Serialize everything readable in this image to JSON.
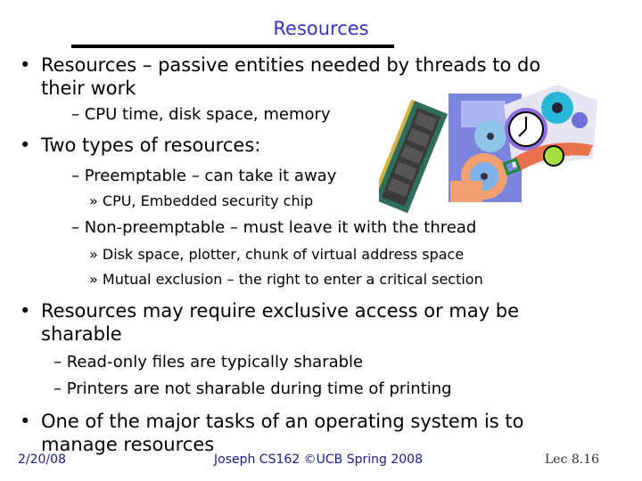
{
  "slide": {
    "title": "Resources",
    "bullets": [
      {
        "marker": "•",
        "text": "Resources – passive entities needed by threads to do their work",
        "line1": "Resources – passive entities needed by threads to do",
        "line2": "their work",
        "sub": [
          {
            "marker": "–",
            "text": "CPU time, disk space, memory"
          }
        ]
      },
      {
        "marker": "•",
        "text": "Two types of resources:",
        "sub": [
          {
            "marker": "–",
            "text": "Preemptable – can take it away",
            "sub": [
              {
                "marker": "»",
                "text": "CPU, Embedded security chip"
              }
            ]
          },
          {
            "marker": "–",
            "text": "Non-preemptable – must leave it with the thread",
            "sub": [
              {
                "marker": "»",
                "text": "Disk space, plotter, chunk of virtual address space"
              },
              {
                "marker": "»",
                "text": "Mutual exclusion – the right to enter a critical section"
              }
            ]
          }
        ]
      },
      {
        "marker": "•",
        "line1": "Resources may require exclusive access or may be",
        "line2": "sharable",
        "sub": [
          {
            "marker": "–",
            "text": "Read-only files are typically sharable"
          },
          {
            "marker": "–",
            "text": "Printers are not sharable during time of printing"
          }
        ]
      },
      {
        "marker": "•",
        "line1": "One of the major tasks of an operating system is to",
        "line2": "manage resources"
      }
    ],
    "clipart": [
      "memory-module-icon",
      "disks-icon",
      "clocks-gears-icon"
    ]
  },
  "footer": {
    "date": "2/20/08",
    "center": "Joseph CS162 ©UCB Spring 2008",
    "page": "Lec 8.16"
  }
}
